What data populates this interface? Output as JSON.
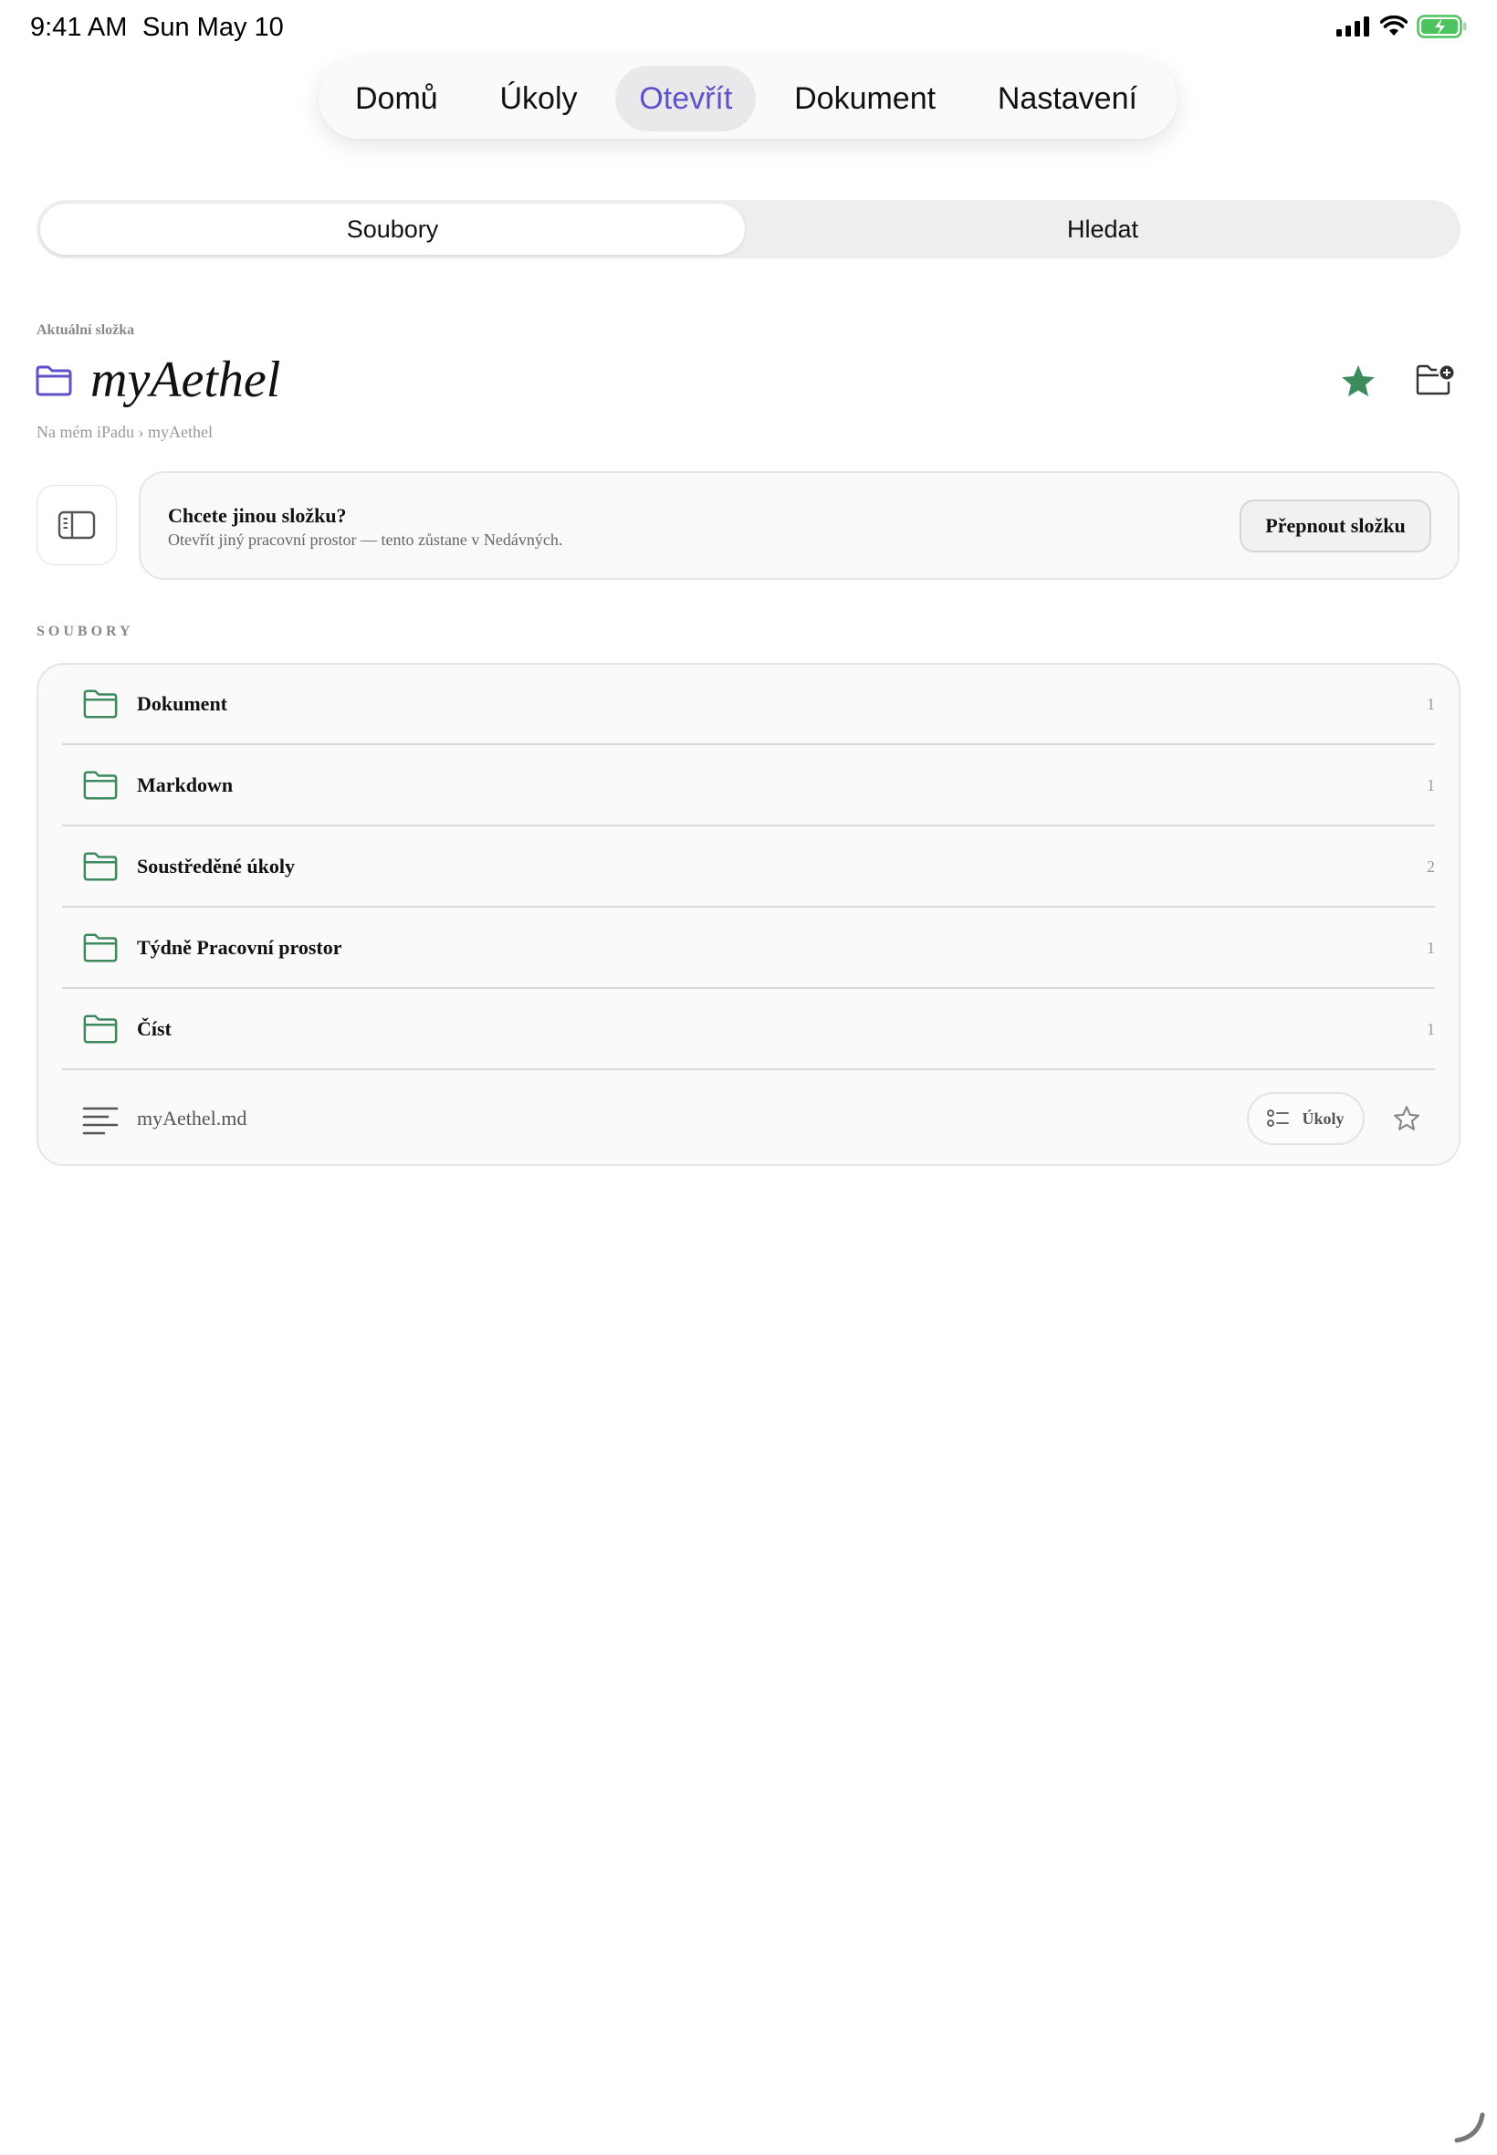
{
  "status_bar": {
    "time": "9:41 AM",
    "date": "Sun May 10",
    "icons": [
      "cellular-signal-icon",
      "wifi-icon",
      "battery-charging-icon"
    ]
  },
  "tabs": [
    {
      "label": "Domů",
      "active": false
    },
    {
      "label": "Úkoly",
      "active": false
    },
    {
      "label": "Otevřít",
      "active": true
    },
    {
      "label": "Dokument",
      "active": false
    },
    {
      "label": "Nastavení",
      "active": false
    }
  ],
  "segmented": {
    "options": [
      "Soubory",
      "Hledat"
    ],
    "selected": "Soubory"
  },
  "current_folder": {
    "label": "Aktuální složka",
    "name": "myAethel",
    "breadcrumb": "Na mém iPadu › myAethel",
    "favorite": true
  },
  "switch_card": {
    "title": "Chcete jinou složku?",
    "subtitle": "Otevřít jiný pracovní prostor — tento zůstane v Nedávných.",
    "button": "Přepnout složku"
  },
  "files": {
    "section_label": "SOUBORY",
    "folders": [
      {
        "name": "Dokument",
        "count": "1"
      },
      {
        "name": "Markdown",
        "count": "1"
      },
      {
        "name": "Soustředěné úkoly",
        "count": "2"
      },
      {
        "name": "Týdně Pracovní prostor",
        "count": "1"
      },
      {
        "name": "Číst",
        "count": "1"
      }
    ],
    "file": {
      "name": "myAethel.md",
      "action_label": "Úkoly",
      "favorite": false
    }
  },
  "colors": {
    "accent_purple": "#5e52c8",
    "folder_green": "#3d8a5c",
    "star_green": "#3d8a5c"
  }
}
